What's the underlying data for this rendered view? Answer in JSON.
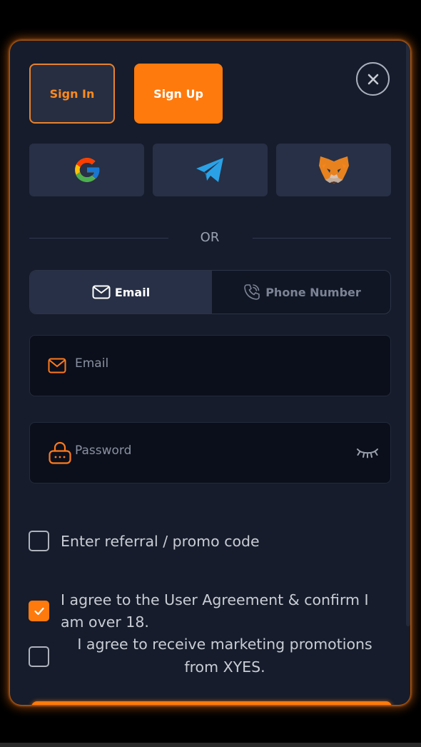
{
  "tabs": {
    "signin_label": "Sign In",
    "signup_label": "Sign Up"
  },
  "divider_text": "OR",
  "method": {
    "email_label": "Email",
    "phone_label": "Phone Number"
  },
  "fields": {
    "email_placeholder": "Email",
    "password_placeholder": "Password"
  },
  "checkboxes": {
    "referral": "Enter referral / promo code",
    "agreement": "I agree to the User Agreement & confirm I am over 18.",
    "marketing_line1": "I agree to receive marketing promotions",
    "marketing_line2": "from XYES."
  },
  "colors": {
    "accent": "#ff7a0c",
    "panel": "#161c2b",
    "card": "#273046",
    "input": "#0b0f1b"
  },
  "icons": [
    "close-icon",
    "google-icon",
    "telegram-icon",
    "metamask-icon",
    "envelope-icon",
    "phone-icon",
    "lock-icon",
    "eye-closed-icon",
    "checkmark-icon"
  ]
}
